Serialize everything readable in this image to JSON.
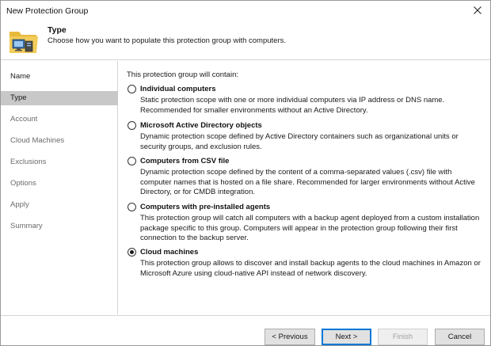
{
  "window": {
    "title": "New Protection Group"
  },
  "header": {
    "title": "Type",
    "subtitle": "Choose how you want to populate this protection group with computers.",
    "icon": "protection-group-folder-icon"
  },
  "sidebar": {
    "items": [
      {
        "label": "Name",
        "state": "done"
      },
      {
        "label": "Type",
        "state": "active"
      },
      {
        "label": "Account",
        "state": "pending"
      },
      {
        "label": "Cloud Machines",
        "state": "pending"
      },
      {
        "label": "Exclusions",
        "state": "pending"
      },
      {
        "label": "Options",
        "state": "pending"
      },
      {
        "label": "Apply",
        "state": "pending"
      },
      {
        "label": "Summary",
        "state": "pending"
      }
    ]
  },
  "main": {
    "intro": "This protection group will contain:",
    "selected_index": 4,
    "options": [
      {
        "title": "Individual computers",
        "description": "Static protection scope with one or more individual computers via IP address or DNS name. Recommended for smaller environments without an Active Directory."
      },
      {
        "title": "Microsoft Active Directory objects",
        "description": "Dynamic protection scope defined by Active Directory containers such as organizational units or security groups, and exclusion rules."
      },
      {
        "title": "Computers from CSV file",
        "description": "Dynamic protection scope defined by the content of a comma-separated values (.csv) file with computer names that is hosted on a file share. Recommended for larger environments without Active Directory, or for CMDB integration."
      },
      {
        "title": "Computers with pre-installed agents",
        "description": "This protection group will catch all computers with a backup agent deployed from a custom installation package specific to this group.  Computers will appear in the protection group following their first connection to the backup server."
      },
      {
        "title": "Cloud machines",
        "description": "This protection group allows to discover and install backup agents to the cloud machines in Amazon or Microsoft Azure using cloud-native API instead of network discovery."
      }
    ]
  },
  "footer": {
    "previous_label": "< Previous",
    "next_label": "Next >",
    "finish_label": "Finish",
    "cancel_label": "Cancel"
  },
  "colors": {
    "active_nav_bg": "#c8c8c8",
    "primary_button_border": "#0078d7",
    "folder_yellow": "#e8b93a"
  }
}
